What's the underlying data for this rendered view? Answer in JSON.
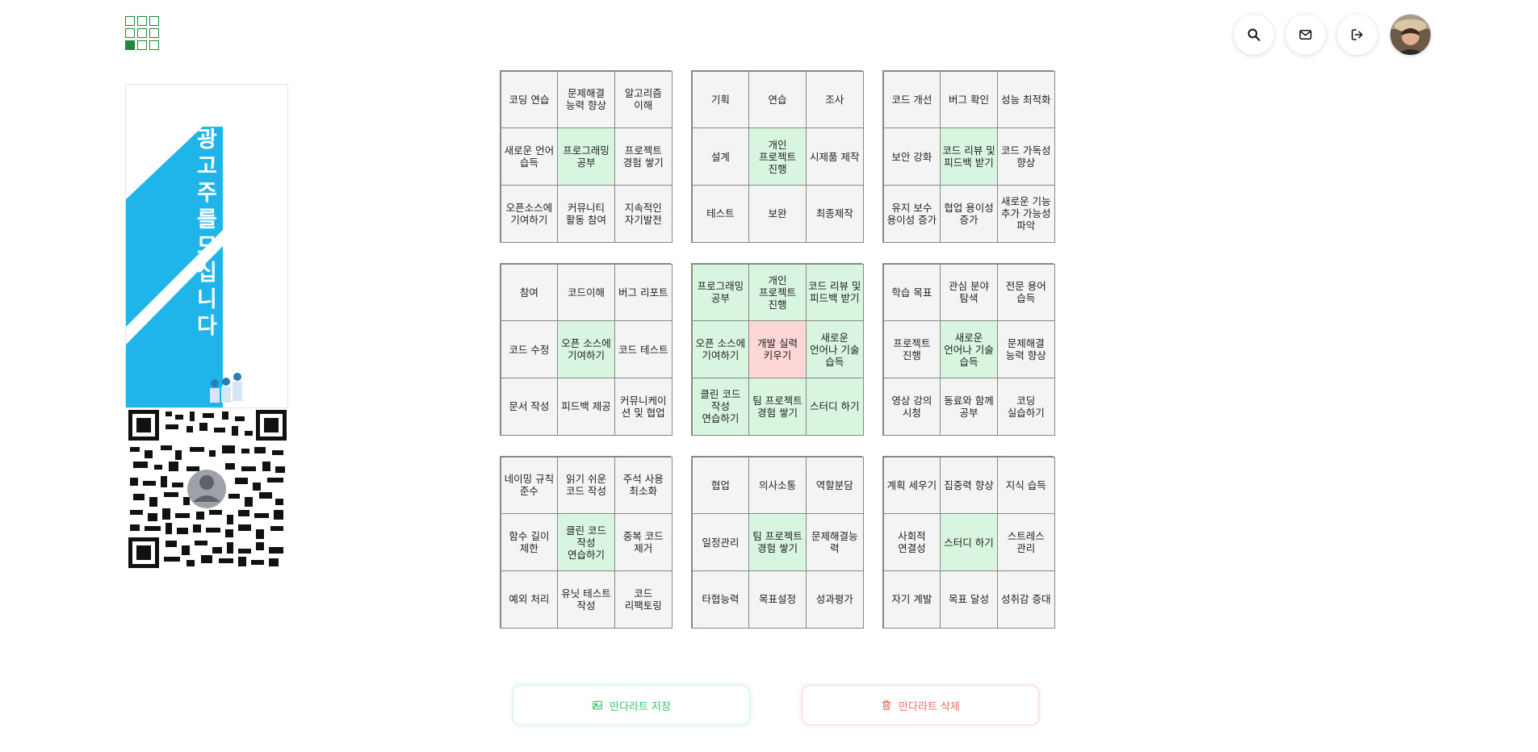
{
  "header": {
    "logo_icon": "grid-logo-icon",
    "actions": [
      {
        "name": "search-button",
        "icon": "search-icon"
      },
      {
        "name": "message-button",
        "icon": "mail-icon"
      },
      {
        "name": "logout-button",
        "icon": "logout-icon"
      }
    ],
    "avatar": "user-avatar"
  },
  "ad": {
    "headline": "광고주를 모십니다",
    "colors": {
      "accent": "#1fb4ea"
    }
  },
  "mandalart": {
    "blocks": [
      {
        "cells": [
          {
            "text": "코딩 연습",
            "state": ""
          },
          {
            "text": "문제해결 능력 향상",
            "state": ""
          },
          {
            "text": "알고리즘 이해",
            "state": ""
          },
          {
            "text": "새로운 언어 습득",
            "state": ""
          },
          {
            "text": "프로그래밍 공부",
            "state": "green"
          },
          {
            "text": "프로젝트 경험 쌓기",
            "state": ""
          },
          {
            "text": "오픈소스에 기여하기",
            "state": ""
          },
          {
            "text": "커뮤니티 활동 참여",
            "state": ""
          },
          {
            "text": "지속적인 자기발전",
            "state": ""
          }
        ]
      },
      {
        "cells": [
          {
            "text": "기획",
            "state": ""
          },
          {
            "text": "연습",
            "state": ""
          },
          {
            "text": "조사",
            "state": ""
          },
          {
            "text": "설계",
            "state": ""
          },
          {
            "text": "개인 프로젝트 진행",
            "state": "green"
          },
          {
            "text": "시제품 제작",
            "state": ""
          },
          {
            "text": "테스트",
            "state": ""
          },
          {
            "text": "보완",
            "state": ""
          },
          {
            "text": "최종제작",
            "state": ""
          }
        ]
      },
      {
        "cells": [
          {
            "text": "코드 개선",
            "state": ""
          },
          {
            "text": "버그 확인",
            "state": ""
          },
          {
            "text": "성능 최적화",
            "state": ""
          },
          {
            "text": "보안 강화",
            "state": ""
          },
          {
            "text": "코드 리뷰 및 피드백 받기",
            "state": "green"
          },
          {
            "text": "코드 가독성 향상",
            "state": ""
          },
          {
            "text": "유지 보수 용이성 증가",
            "state": ""
          },
          {
            "text": "협업 용이성 증가",
            "state": ""
          },
          {
            "text": "새로운 기능 추가 가능성 파악",
            "state": ""
          }
        ]
      },
      {
        "cells": [
          {
            "text": "참여",
            "state": ""
          },
          {
            "text": "코드이해",
            "state": ""
          },
          {
            "text": "버그 리포트",
            "state": ""
          },
          {
            "text": "코드 수정",
            "state": ""
          },
          {
            "text": "오픈 소스에 기여하기",
            "state": "green"
          },
          {
            "text": "코드 테스트",
            "state": ""
          },
          {
            "text": "문서 작성",
            "state": ""
          },
          {
            "text": "피드백 제공",
            "state": ""
          },
          {
            "text": "커뮤니케이션 및 협업",
            "state": ""
          }
        ]
      },
      {
        "cells": [
          {
            "text": "프로그래밍 공부",
            "state": "green"
          },
          {
            "text": "개인 프로젝트 진행",
            "state": "green"
          },
          {
            "text": "코드 리뷰 및 피드백 받기",
            "state": "green"
          },
          {
            "text": "오픈 소스에 기여하기",
            "state": "green"
          },
          {
            "text": "개발 실력 키우기",
            "state": "red"
          },
          {
            "text": "새로운 언어나 기술 습득",
            "state": "green"
          },
          {
            "text": "클린 코드 작성 연습하기",
            "state": "green"
          },
          {
            "text": "팀 프로젝트 경험 쌓기",
            "state": "green"
          },
          {
            "text": "스터디 하기",
            "state": "green"
          }
        ]
      },
      {
        "cells": [
          {
            "text": "학습 목표",
            "state": ""
          },
          {
            "text": "관심 분야 탐색",
            "state": ""
          },
          {
            "text": "전문 용어 습득",
            "state": ""
          },
          {
            "text": "프로젝트 진행",
            "state": ""
          },
          {
            "text": "새로운 언어나 기술 습득",
            "state": "green"
          },
          {
            "text": "문제해결 능력 향상",
            "state": ""
          },
          {
            "text": "영상 강의 시청",
            "state": ""
          },
          {
            "text": "동료와 함께 공부",
            "state": ""
          },
          {
            "text": "코딩 실습하기",
            "state": ""
          }
        ]
      },
      {
        "cells": [
          {
            "text": "네이밍 규칙 준수",
            "state": ""
          },
          {
            "text": "읽기 쉬운 코드 작성",
            "state": ""
          },
          {
            "text": "주석 사용 최소화",
            "state": ""
          },
          {
            "text": "함수 길이 제한",
            "state": ""
          },
          {
            "text": "클린 코드 작성 연습하기",
            "state": "green"
          },
          {
            "text": "중복 코드 제거",
            "state": ""
          },
          {
            "text": "예외 처리",
            "state": ""
          },
          {
            "text": "유닛 테스트 작성",
            "state": ""
          },
          {
            "text": "코드 리팩토링",
            "state": ""
          }
        ]
      },
      {
        "cells": [
          {
            "text": "협업",
            "state": ""
          },
          {
            "text": "의사소통",
            "state": ""
          },
          {
            "text": "역할분담",
            "state": ""
          },
          {
            "text": "일정관리",
            "state": ""
          },
          {
            "text": "팀 프로젝트 경험 쌓기",
            "state": "green"
          },
          {
            "text": "문제해결능력",
            "state": ""
          },
          {
            "text": "타협능력",
            "state": ""
          },
          {
            "text": "목표설정",
            "state": ""
          },
          {
            "text": "성과평가",
            "state": ""
          }
        ]
      },
      {
        "cells": [
          {
            "text": "계획 세우기",
            "state": ""
          },
          {
            "text": "집중력 향상",
            "state": ""
          },
          {
            "text": "지식 습득",
            "state": ""
          },
          {
            "text": "사회적 연결성",
            "state": ""
          },
          {
            "text": "스터디 하기",
            "state": "green"
          },
          {
            "text": "스트레스 관리",
            "state": ""
          },
          {
            "text": "자기 계발",
            "state": ""
          },
          {
            "text": "목표 달성",
            "state": ""
          },
          {
            "text": "성취감 증대",
            "state": ""
          }
        ]
      }
    ]
  },
  "buttons": {
    "save_label": "만다라트 저장",
    "save_icon": "image-icon",
    "delete_label": "만다라트 삭제",
    "delete_icon": "trash-icon",
    "colors": {
      "save": "#3cc36a",
      "delete": "#ef6b5b"
    }
  }
}
